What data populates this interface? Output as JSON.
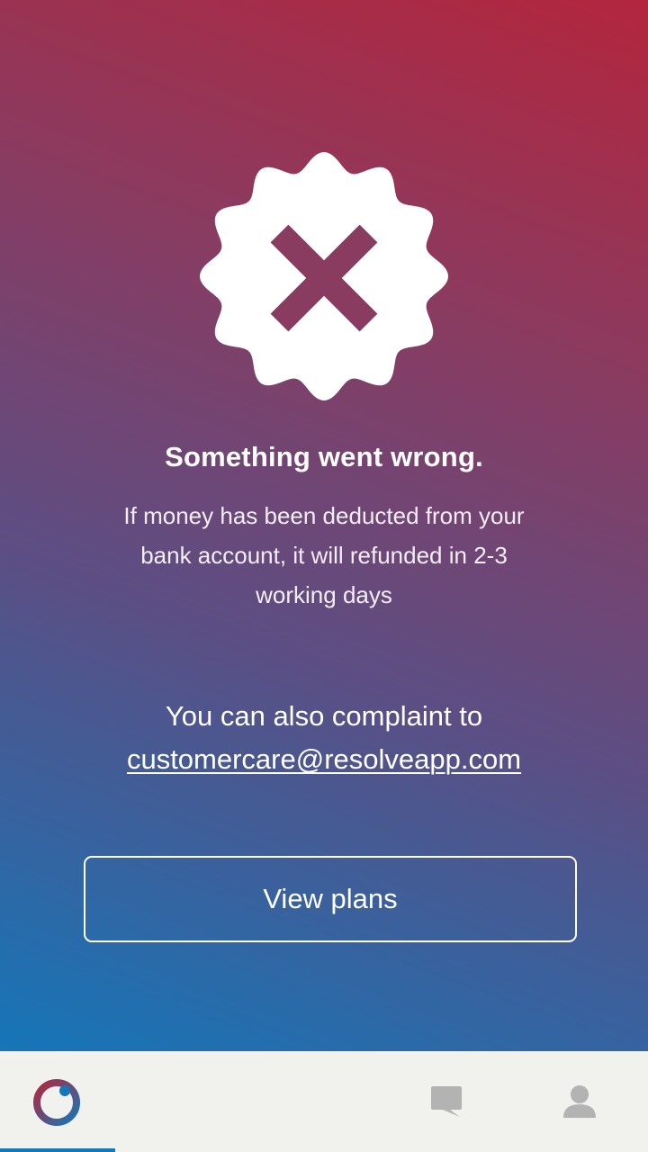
{
  "error": {
    "title": "Something went wrong.",
    "message": "If money has been deducted from your bank account, it will refunded in 2-3 working days",
    "complaint_text": "You can also complaint to",
    "complaint_email": "customercare@resolveapp.com"
  },
  "actions": {
    "view_plans_label": "View plans"
  },
  "tabbar": {
    "items": [
      {
        "icon": "app-logo-icon",
        "active": true
      },
      {
        "icon": "chat-icon",
        "active": false
      },
      {
        "icon": "profile-icon",
        "active": false
      }
    ]
  },
  "colors": {
    "gradient_top_right": "#b3263e",
    "gradient_bottom_left": "#1576b8",
    "badge_fill": "#ffffff",
    "x_mark": "#8a3b60",
    "tabbar_bg": "#f1f2ee",
    "tab_inactive": "#b3b3b3",
    "tab_indicator": "#1576b8"
  }
}
